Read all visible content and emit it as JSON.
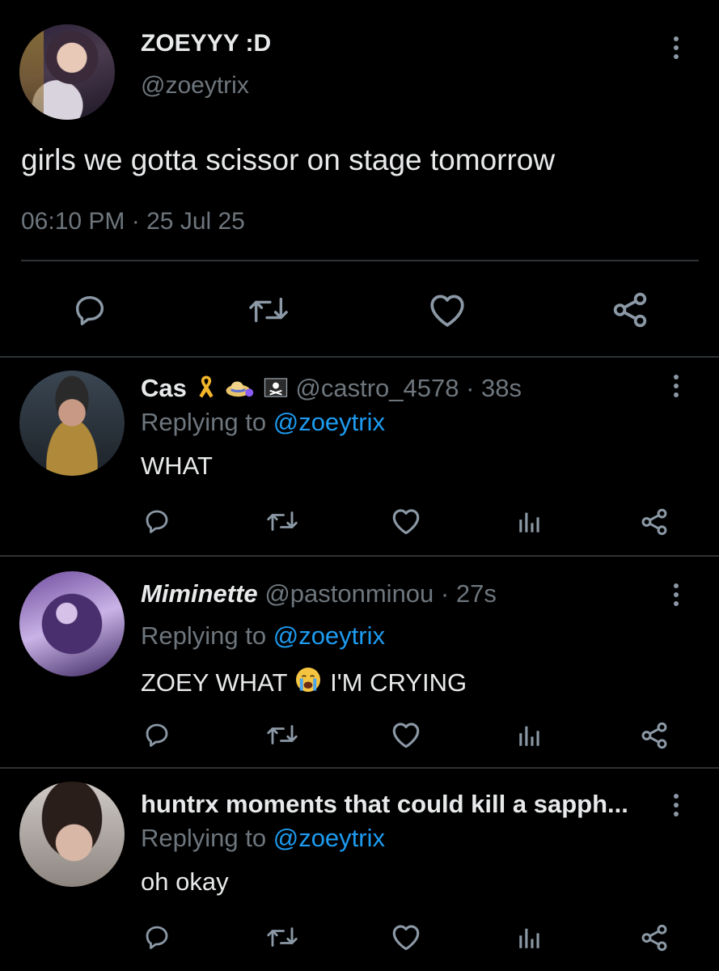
{
  "tweet": {
    "display_name": "ZOEYYY :D",
    "handle": "@zoeytrix",
    "text": "girls we gotta scissor on stage tomorrow",
    "time": "06:10 PM",
    "separator": "·",
    "date": "25 Jul 25"
  },
  "replies": [
    {
      "display_name": "Cas",
      "handle": "@castro_4578",
      "separator": "·",
      "time": "38s",
      "replying_prefix": "Replying to",
      "replying_handle": "@zoeytrix",
      "text": "WHAT"
    },
    {
      "display_name": "Miminette",
      "handle": "@pastonminou",
      "separator": "·",
      "time": "27s",
      "replying_prefix": "Replying to",
      "replying_handle": "@zoeytrix",
      "text_before": "ZOEY WHAT",
      "text_after": "I'M CRYING"
    },
    {
      "display_name": "huntrx moments that could kill a sapph...",
      "replying_prefix": "Replying to",
      "replying_handle": "@zoeytrix",
      "text": "oh okay"
    }
  ],
  "colors": {
    "background": "#000000",
    "text": "#e7e9ea",
    "muted": "#6e767d",
    "link": "#1d9bf0",
    "divider": "#2f3336"
  },
  "icons": [
    "more-vertical-icon",
    "reply-icon",
    "retweet-icon",
    "like-icon",
    "share-icon",
    "views-icon",
    "ribbon-emoji",
    "hat-emoji",
    "pirate-flag-emoji",
    "crying-emoji"
  ]
}
